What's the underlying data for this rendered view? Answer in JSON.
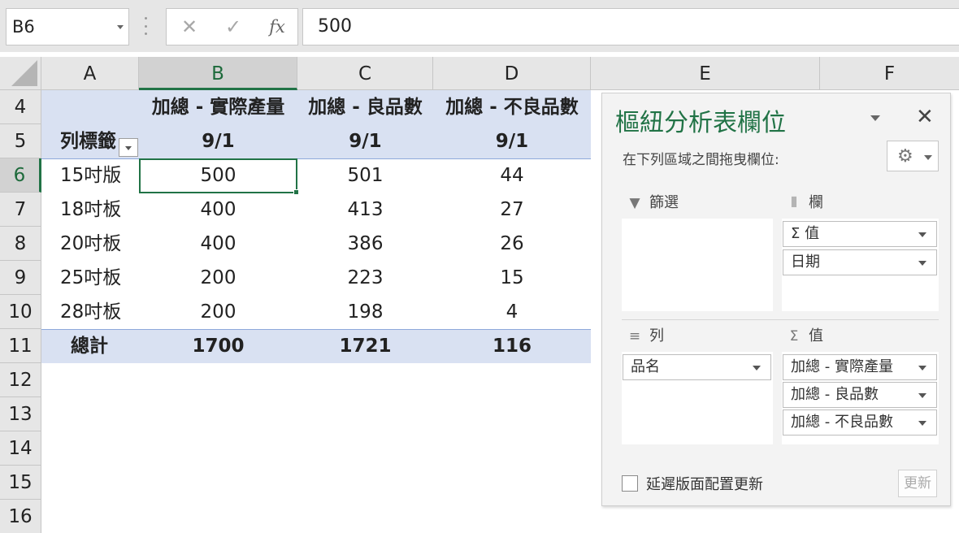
{
  "formula_bar": {
    "name_box": "B6",
    "cancel_symbol": "✕",
    "enter_symbol": "✓",
    "fx_symbol": "fx",
    "value": "500"
  },
  "columns": [
    "A",
    "B",
    "C",
    "D",
    "E",
    "F"
  ],
  "selected_column": "B",
  "rows": [
    "4",
    "5",
    "6",
    "7",
    "8",
    "9",
    "10",
    "11",
    "12",
    "13",
    "14",
    "15",
    "16"
  ],
  "selected_row": "6",
  "pivot": {
    "header_labels": [
      "加總 - 實際產量",
      "加總 - 良品數",
      "加總 - 不良品數"
    ],
    "row_label_title": "列標籤",
    "dates": [
      "9/1",
      "9/1",
      "9/1"
    ],
    "data_rows": [
      {
        "name": "15吋版",
        "values": [
          "500",
          "501",
          "44"
        ]
      },
      {
        "name": "18吋板",
        "values": [
          "400",
          "413",
          "27"
        ]
      },
      {
        "name": "20吋板",
        "values": [
          "400",
          "386",
          "26"
        ]
      },
      {
        "name": "25吋板",
        "values": [
          "200",
          "223",
          "15"
        ]
      },
      {
        "name": "28吋板",
        "values": [
          "200",
          "198",
          "4"
        ]
      }
    ],
    "total": {
      "name": "總計",
      "values": [
        "1700",
        "1721",
        "116"
      ]
    }
  },
  "field_pane": {
    "title": "樞紐分析表欄位",
    "close_symbol": "✕",
    "subtitle": "在下列區域之間拖曳欄位:",
    "gear_symbol": "⚙",
    "areas": {
      "filters": {
        "title": "篩選",
        "icon": "▼",
        "items": []
      },
      "columns": {
        "title": "欄",
        "icon": "⦀",
        "items": [
          "Σ 值",
          "日期"
        ]
      },
      "rows": {
        "title": "列",
        "icon": "≡",
        "items": [
          "品名"
        ]
      },
      "values": {
        "title": "值",
        "icon": "Σ",
        "items": [
          "加總 - 實際產量",
          "加總 - 良品數",
          "加總 - 不良品數"
        ]
      }
    },
    "defer_label": "延遲版面配置更新",
    "update_label": "更新"
  },
  "colors": {
    "accent_green": "#217346",
    "pivot_band": "#d9e1f2",
    "pivot_line": "#8ea9db"
  }
}
